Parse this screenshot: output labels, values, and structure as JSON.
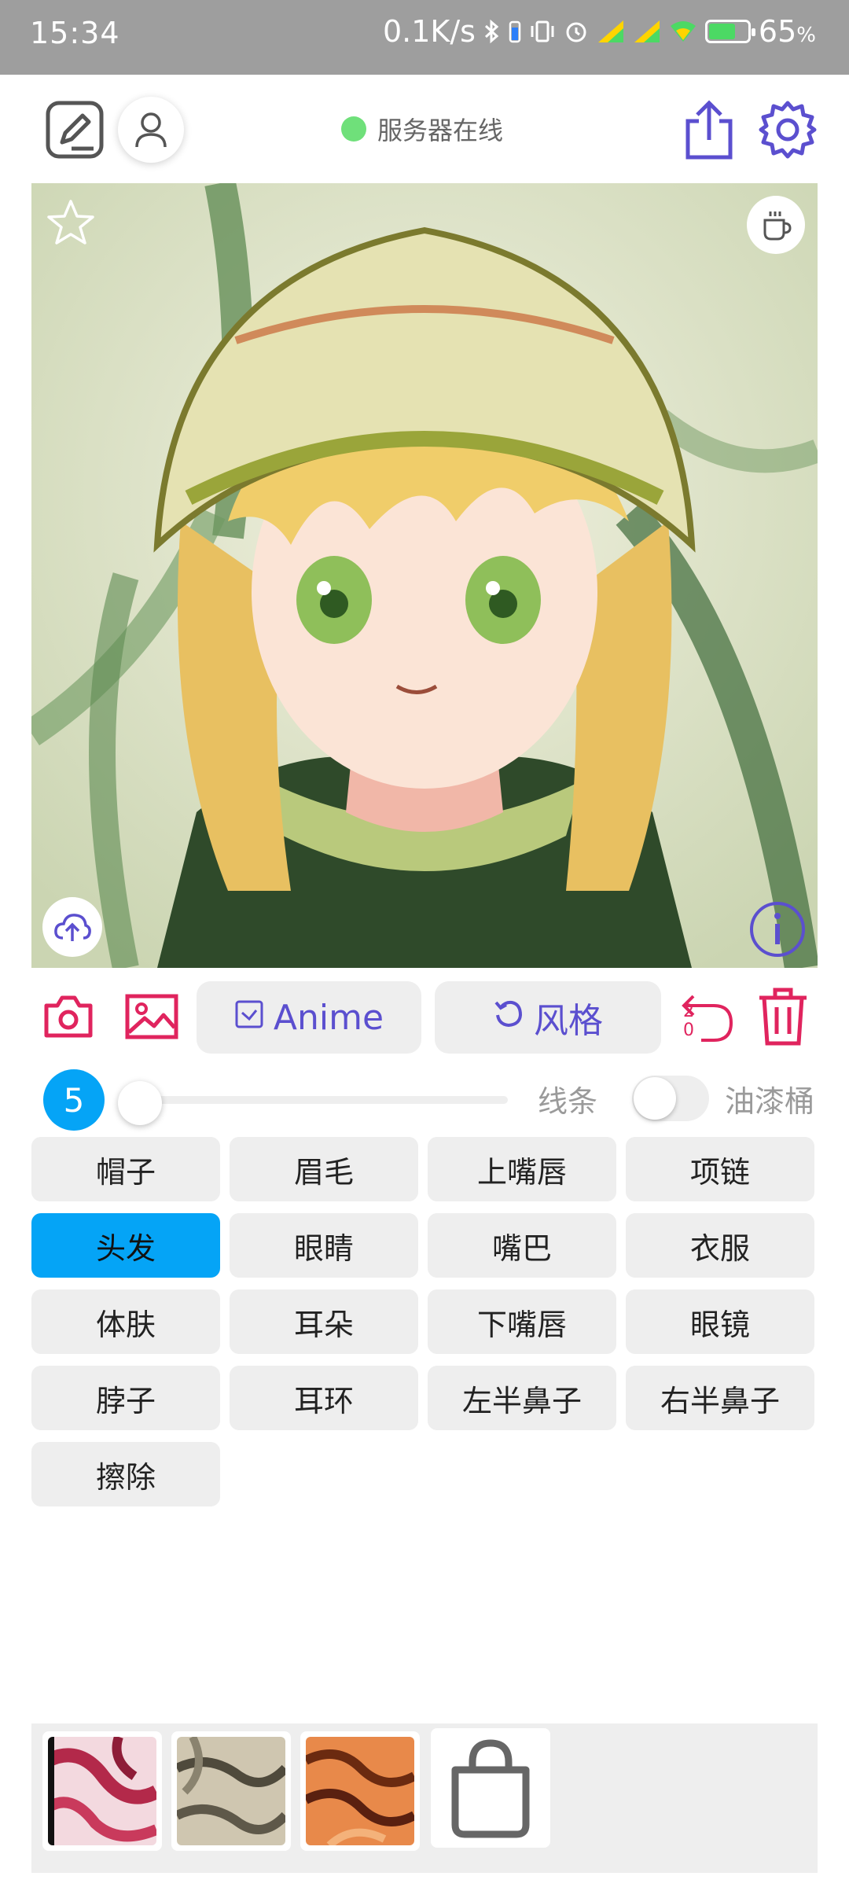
{
  "status_bar": {
    "time": "15:34",
    "net_speed": "0.1K/s",
    "battery_percent": "65",
    "battery_suffix": "%",
    "battery_level": 0.65,
    "icons": [
      "bluetooth-icon",
      "battery-small-icon",
      "vibrate-icon",
      "alarm-icon",
      "signal-hd-icon",
      "signal-hd-icon",
      "wifi-icon",
      "battery-charging-icon"
    ]
  },
  "toolbar": {
    "server_status": "服务器在线",
    "server_status_color": "#6fe07a",
    "icons": [
      "edit-sketch-icon",
      "user-icon",
      "share-icon",
      "settings-gear-icon"
    ]
  },
  "canvas": {
    "icons": [
      "star-icon",
      "coffee-icon",
      "cloud-upload-icon",
      "info-icon"
    ]
  },
  "actions": {
    "anime_label": "Anime",
    "style_label": "风格",
    "undo_count_top": "2",
    "undo_count_bottom": "0",
    "icons": [
      "camera-icon",
      "image-gallery-icon",
      "checkbox-icon",
      "refresh-icon",
      "undo-icon",
      "trash-icon"
    ]
  },
  "brush": {
    "size": "5",
    "slider_level": 0.0,
    "lines_label": "线条",
    "bucket_label": "油漆桶",
    "bucket_enabled": false
  },
  "parts": [
    {
      "label": "帽子",
      "active": false
    },
    {
      "label": "眉毛",
      "active": false
    },
    {
      "label": "上嘴唇",
      "active": false
    },
    {
      "label": "项链",
      "active": false
    },
    {
      "label": "头发",
      "active": true
    },
    {
      "label": "眼睛",
      "active": false
    },
    {
      "label": "嘴巴",
      "active": false
    },
    {
      "label": "衣服",
      "active": false
    },
    {
      "label": "体肤",
      "active": false
    },
    {
      "label": "耳朵",
      "active": false
    },
    {
      "label": "下嘴唇",
      "active": false
    },
    {
      "label": "眼镜",
      "active": false
    },
    {
      "label": "脖子",
      "active": false
    },
    {
      "label": "耳环",
      "active": false
    },
    {
      "label": "左半鼻子",
      "active": false
    },
    {
      "label": "右半鼻子",
      "active": false
    },
    {
      "label": "擦除",
      "active": false
    }
  ],
  "tray": {
    "icons": [
      "texture-red-swatch",
      "texture-gray-swatch",
      "texture-orange-swatch",
      "shopping-bag-icon"
    ]
  },
  "colors": {
    "accent_blue": "#05a4f6",
    "accent_purple": "#5b4fcf",
    "accent_red": "#e0245e",
    "button_bg": "#eeeeee"
  }
}
